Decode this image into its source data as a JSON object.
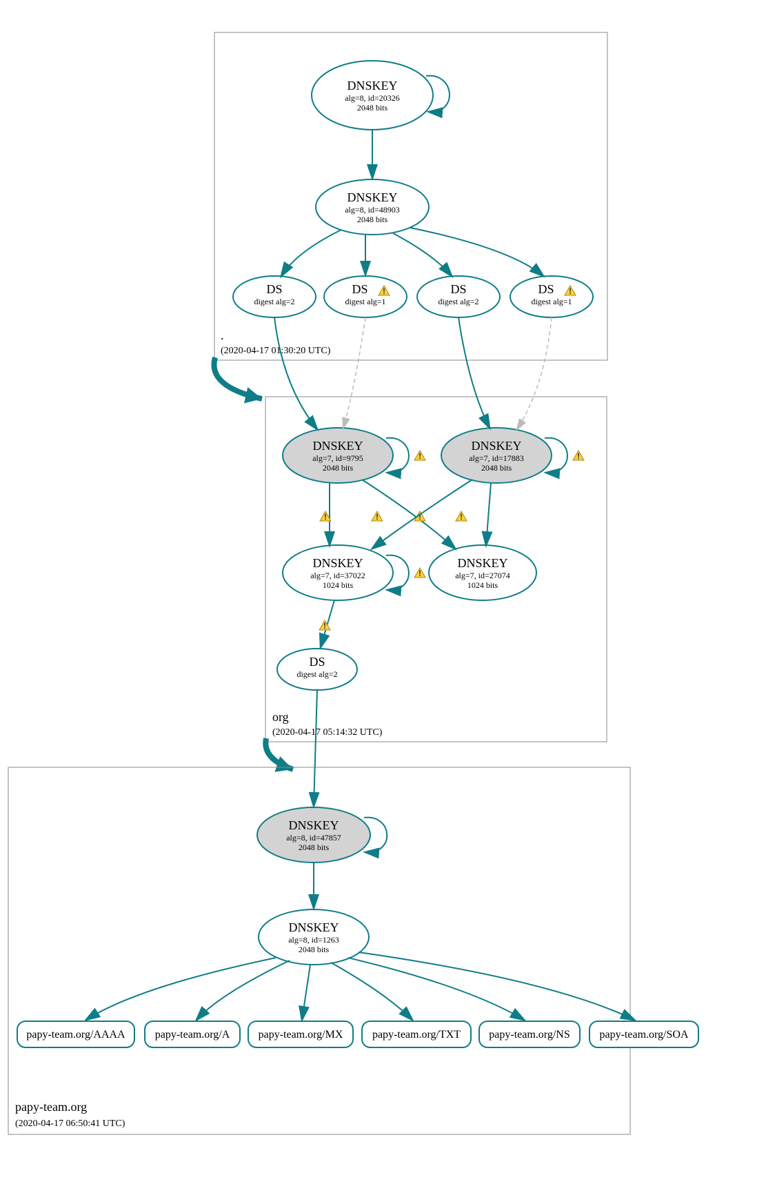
{
  "zones": {
    "root": {
      "label": ".",
      "timestamp": "(2020-04-17 01:30:20 UTC)"
    },
    "org": {
      "label": "org",
      "timestamp": "(2020-04-17 05:14:32 UTC)"
    },
    "domain": {
      "label": "papy-team.org",
      "timestamp": "(2020-04-17 06:50:41 UTC)"
    }
  },
  "nodes": {
    "root_ksk": {
      "title": "DNSKEY",
      "line1": "alg=8, id=20326",
      "line2": "2048 bits"
    },
    "root_zsk": {
      "title": "DNSKEY",
      "line1": "alg=8, id=48903",
      "line2": "2048 bits"
    },
    "ds1": {
      "title": "DS",
      "line1": "digest alg=2"
    },
    "ds2": {
      "title": "DS",
      "line1": "digest alg=1"
    },
    "ds3": {
      "title": "DS",
      "line1": "digest alg=2"
    },
    "ds4": {
      "title": "DS",
      "line1": "digest alg=1"
    },
    "org_ksk1": {
      "title": "DNSKEY",
      "line1": "alg=7, id=9795",
      "line2": "2048 bits"
    },
    "org_ksk2": {
      "title": "DNSKEY",
      "line1": "alg=7, id=17883",
      "line2": "2048 bits"
    },
    "org_zsk1": {
      "title": "DNSKEY",
      "line1": "alg=7, id=37022",
      "line2": "1024 bits"
    },
    "org_zsk2": {
      "title": "DNSKEY",
      "line1": "alg=7, id=27074",
      "line2": "1024 bits"
    },
    "org_ds": {
      "title": "DS",
      "line1": "digest alg=2"
    },
    "dom_ksk": {
      "title": "DNSKEY",
      "line1": "alg=8, id=47857",
      "line2": "2048 bits"
    },
    "dom_zsk": {
      "title": "DNSKEY",
      "line1": "alg=8, id=1263",
      "line2": "2048 bits"
    }
  },
  "rrsets": {
    "aaaa": "papy-team.org/AAAA",
    "a": "papy-team.org/A",
    "mx": "papy-team.org/MX",
    "txt": "papy-team.org/TXT",
    "ns": "papy-team.org/NS",
    "soa": "papy-team.org/SOA"
  }
}
